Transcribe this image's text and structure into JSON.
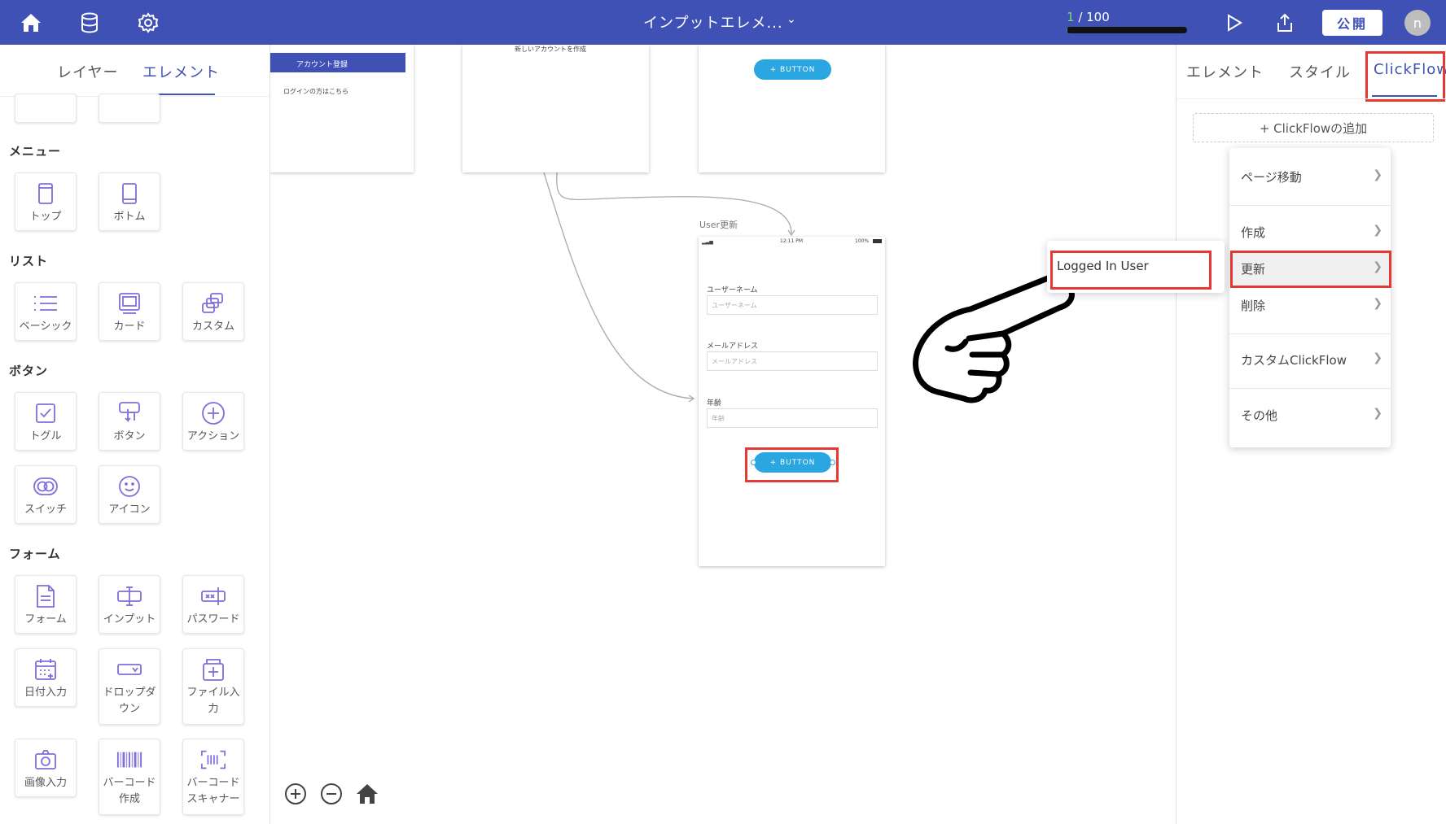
{
  "app": {
    "title": "インプットエレメ...",
    "progress": {
      "current": "1",
      "total": " / 100",
      "fraction": 0.01
    },
    "publish_label": "公開",
    "avatar_initial": "n"
  },
  "left_panel": {
    "tabs": [
      "レイヤー",
      "エレメント"
    ],
    "active_tab": "エレメント",
    "sections": {
      "menu": {
        "title": "メニュー",
        "items": [
          "トップ",
          "ボトム"
        ]
      },
      "list": {
        "title": "リスト",
        "items": [
          "ベーシック",
          "カード",
          "カスタム"
        ]
      },
      "button": {
        "title": "ボタン",
        "items": [
          "トグル",
          "ボタン",
          "アクション",
          "スイッチ",
          "アイコン"
        ]
      },
      "form": {
        "title": "フォーム",
        "items": [
          "フォーム",
          "インプット",
          "パスワード",
          "日付入力",
          "ドロップダウン",
          "ファイル入力",
          "画像入力",
          "バーコード作成",
          "バーコードスキャナー"
        ]
      }
    }
  },
  "canvas": {
    "frame1": {
      "header": "アカウント登録",
      "link": "ログインの方はこちら"
    },
    "frame2": {
      "text": "新しいアカウントを作成"
    },
    "frame3": {
      "button_label": "+ BUTTON"
    },
    "main_frame": {
      "label": "User更新",
      "status_time": "12:11 PM",
      "status_battery": "100%",
      "fields": [
        {
          "label": "ユーザーネーム",
          "placeholder": "ユーザーネーム"
        },
        {
          "label": "メールアドレス",
          "placeholder": "メールアドレス"
        },
        {
          "label": "年齢",
          "placeholder": "年齢"
        }
      ],
      "button_label": "+ BUTTON"
    }
  },
  "right_panel": {
    "tabs": [
      "エレメント",
      "スタイル",
      "ClickFlow"
    ],
    "active_tab": "ClickFlow",
    "add_button": "+ ClickFlowの追加",
    "menu_items": [
      "ページ移動",
      "作成",
      "更新",
      "削除",
      "カスタムClickFlow",
      "その他"
    ],
    "submenu_item": "Logged In User"
  },
  "colors": {
    "header": "#3f51b5",
    "accent": "#3f51b5",
    "highlight": "#e53935",
    "button": "#2aa6e0",
    "icon": "#7e6fd9"
  }
}
